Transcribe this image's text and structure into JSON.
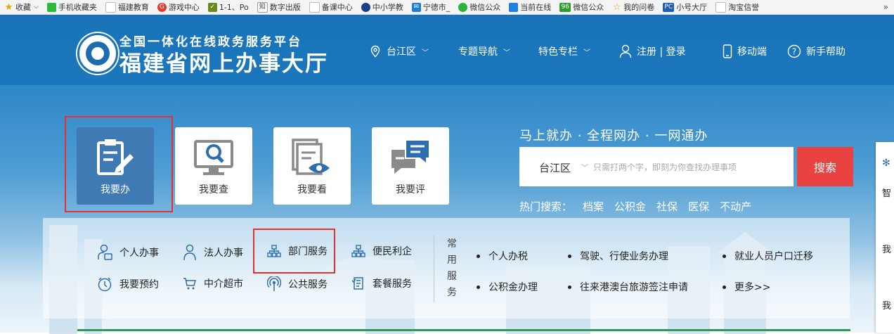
{
  "bookmarks": [
    {
      "label": "收藏",
      "icon": "star-icon",
      "color": "#e9a300"
    },
    {
      "label": "手机收藏夹",
      "icon": "phone-icon",
      "color": "#2dbb3a"
    },
    {
      "label": "福建教育",
      "icon": "page-icon",
      "color": "#bbbbbb"
    },
    {
      "label": "游戏中心",
      "icon": "game-icon",
      "color": "#e03b2e"
    },
    {
      "label": "1-1、Po",
      "icon": "check-icon",
      "color": "#6a8a1f"
    },
    {
      "label": "数字出版",
      "icon": "zhi-icon",
      "color": "#444444"
    },
    {
      "label": "备课中心",
      "icon": "page-icon",
      "color": "#bbbbbb"
    },
    {
      "label": "中小学教",
      "icon": "globe-icon",
      "color": "#1b3f8a"
    },
    {
      "label": "宁德市_",
      "icon": "mail-icon",
      "color": "#1f7fd0"
    },
    {
      "label": "微信公众",
      "icon": "wechat-icon",
      "color": "#2cb43a"
    },
    {
      "label": "当前在线",
      "icon": "robot-icon",
      "color": "#1f80e0"
    },
    {
      "label": "微信公众",
      "icon": "96-icon",
      "color": "#2d9b2d"
    },
    {
      "label": "我的问卷",
      "icon": "star-icon",
      "color": "#e9a300"
    },
    {
      "label": "小号大厅",
      "icon": "pc-icon",
      "color": "#1b5fb5"
    },
    {
      "label": "淘宝信誉",
      "icon": "page-icon",
      "color": "#bbbbbb"
    }
  ],
  "header": {
    "subtitle": "全国一体化在线政务服务平台",
    "title": "福建省网上办事大厅",
    "location": "台江区",
    "nav_topics": "专题导航",
    "nav_special": "特色专栏",
    "login": "注册 | 登录",
    "mobile": "移动端",
    "help": "新手帮助"
  },
  "tiles": [
    {
      "label": "我要办",
      "icon": "handle-icon"
    },
    {
      "label": "我要查",
      "icon": "query-icon"
    },
    {
      "label": "我要看",
      "icon": "view-icon"
    },
    {
      "label": "我要评",
      "icon": "comment-icon"
    }
  ],
  "search": {
    "slogan": "马上就办 · 全程网办 · 一网通办",
    "region": "台江区",
    "placeholder": "只需打两个字，即刻为你查找办理事项",
    "button": "搜索",
    "hot_label": "热门搜索：",
    "hot_items": [
      "档案",
      "公积金",
      "社保",
      "医保",
      "不动产"
    ]
  },
  "menu": {
    "row1": [
      "个人办事",
      "法人办事",
      "部门服务",
      "便民利企"
    ],
    "row2": [
      "我要预约",
      "中介超市",
      "公共服务",
      "套餐服务"
    ]
  },
  "common": {
    "label": "常用服务",
    "row1": [
      "个人办税",
      "驾驶、行使业务办理",
      "就业人员户口迁移"
    ],
    "row2": [
      "公积金办理",
      "往来港澳台旅游签注申请",
      "更多>>"
    ]
  },
  "side": {
    "items": [
      "智",
      "我",
      "我"
    ]
  },
  "colors": {
    "header_blue": "#1a73b8",
    "search_red": "#e84340",
    "active_tile": "#3f7ab4",
    "highlight_red": "#e53030"
  }
}
